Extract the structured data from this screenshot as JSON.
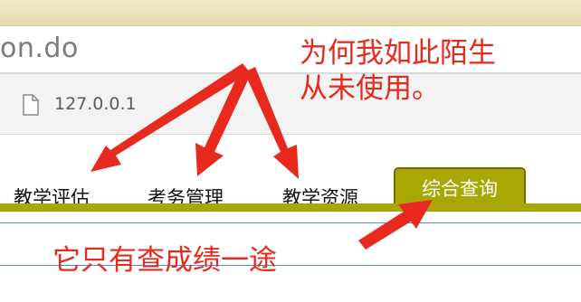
{
  "browser": {
    "page_title_fragment": "on.do",
    "address": "127.0.0.1",
    "page_icon": "document-icon"
  },
  "nav": {
    "items": [
      {
        "label": "教学评估"
      },
      {
        "label": "考务管理"
      },
      {
        "label": "教学资源"
      }
    ],
    "active": {
      "label": "综合查询"
    }
  },
  "annotations": {
    "top_line1": "为何我如此陌生",
    "top_line2": "从未使用。",
    "bottom": "它只有查成绩一途"
  },
  "colors": {
    "nav_accent": "#a8a705",
    "annotation": "#e8291d",
    "rule_lines": "#4a8fd6"
  }
}
